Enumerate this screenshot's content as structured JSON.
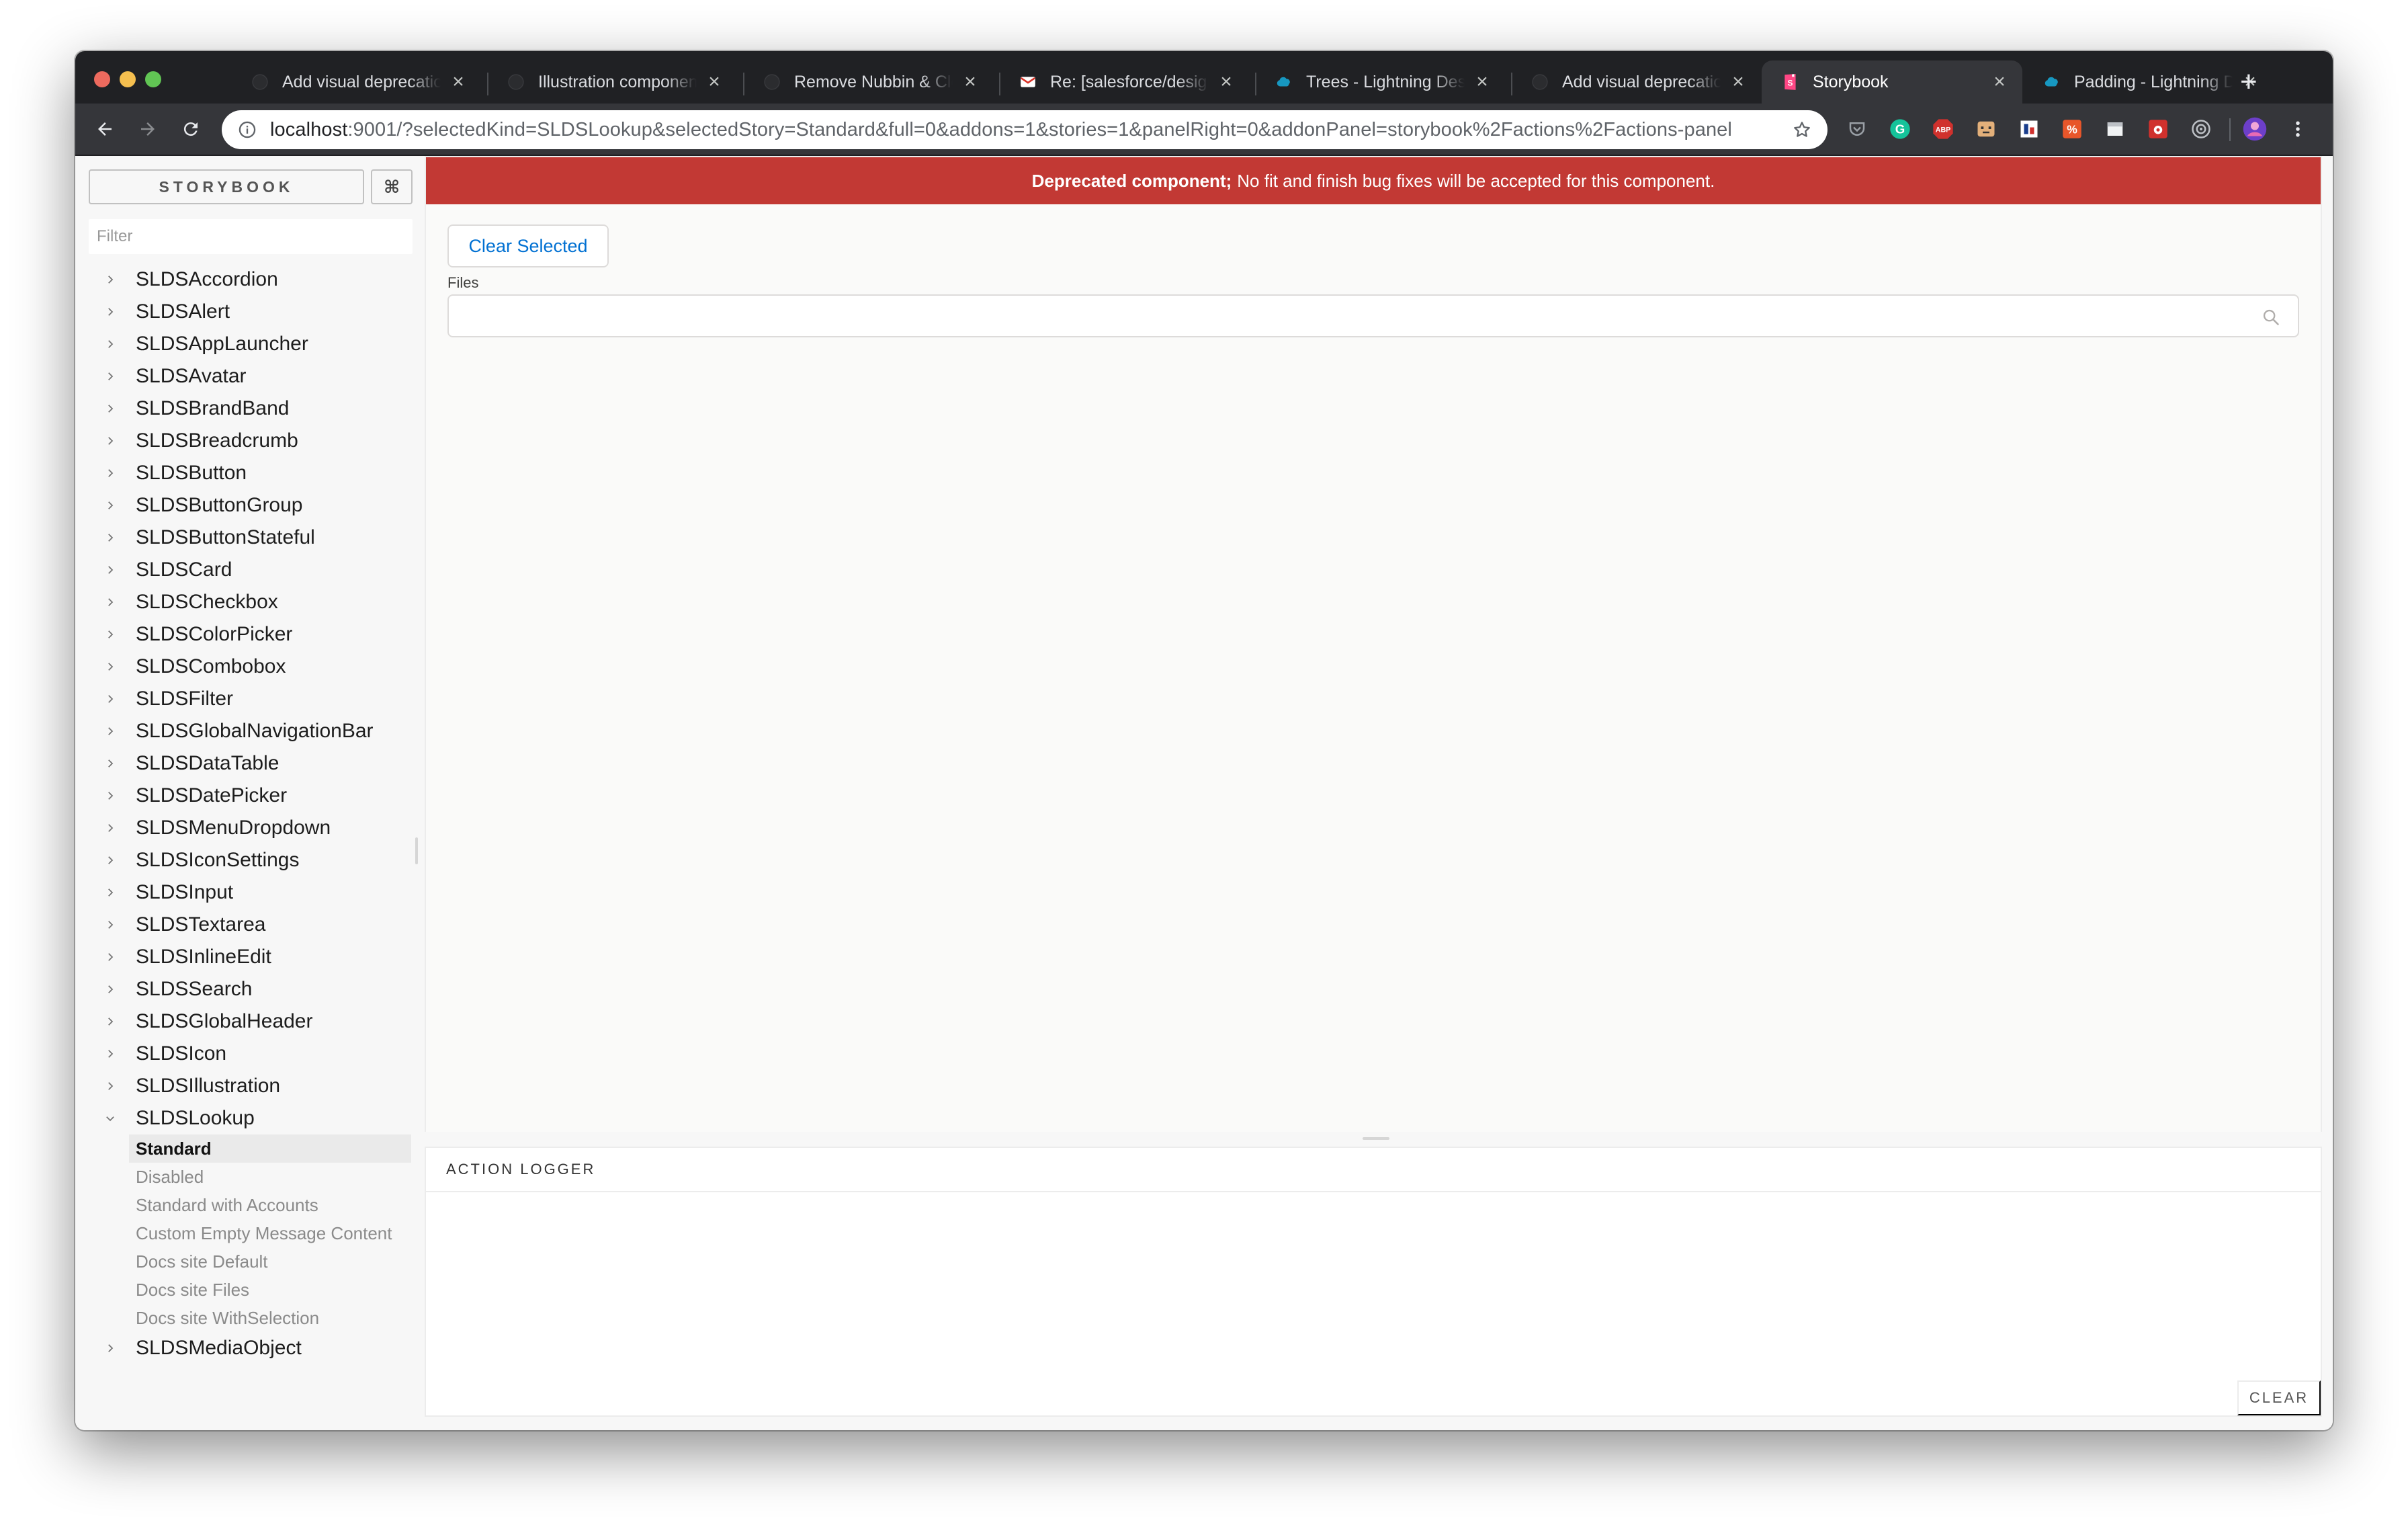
{
  "tabs": [
    {
      "title": "Add visual deprecation",
      "favicon": "github-icon",
      "active": false
    },
    {
      "title": "Illustration component",
      "favicon": "github-icon",
      "active": false
    },
    {
      "title": "Remove Nubbin & Close",
      "favicon": "github-icon",
      "active": false
    },
    {
      "title": "Re: [salesforce/design",
      "favicon": "gmail-icon",
      "active": false
    },
    {
      "title": "Trees - Lightning Design",
      "favicon": "salesforce-cloud-icon",
      "active": false
    },
    {
      "title": "Add visual deprecation",
      "favicon": "github-icon",
      "active": false
    },
    {
      "title": "Storybook",
      "favicon": "storybook-icon",
      "active": true
    },
    {
      "title": "Padding - Lightning Design",
      "favicon": "salesforce-cloud-icon",
      "active": false
    }
  ],
  "toolbar": {
    "url_host": "localhost",
    "url_rest": ":9001/?selectedKind=SLDSLookup&selectedStory=Standard&full=0&addons=1&stories=1&panelRight=0&addonPanel=storybook%2Factions%2Factions-panel"
  },
  "sidebar": {
    "brand": "STORYBOOK",
    "shortcuts_label": "⌘",
    "filter_placeholder": "Filter",
    "kinds_before": [
      "SLDSAccordion",
      "SLDSAlert",
      "SLDSAppLauncher",
      "SLDSAvatar",
      "SLDSBrandBand",
      "SLDSBreadcrumb",
      "SLDSButton",
      "SLDSButtonGroup",
      "SLDSButtonStateful",
      "SLDSCard",
      "SLDSCheckbox",
      "SLDSColorPicker",
      "SLDSCombobox",
      "SLDSFilter",
      "SLDSGlobalNavigationBar",
      "SLDSDataTable",
      "SLDSDatePicker",
      "SLDSMenuDropdown",
      "SLDSIconSettings",
      "SLDSInput",
      "SLDSTextarea",
      "SLDSInlineEdit",
      "SLDSSearch",
      "SLDSGlobalHeader",
      "SLDSIcon",
      "SLDSIllustration"
    ],
    "expanded_kind": "SLDSLookup",
    "stories": [
      {
        "label": "Standard",
        "selected": true
      },
      {
        "label": "Disabled",
        "selected": false
      },
      {
        "label": "Standard with Accounts",
        "selected": false
      },
      {
        "label": "Custom Empty Message Content",
        "selected": false
      },
      {
        "label": "Docs site Default",
        "selected": false
      },
      {
        "label": "Docs site Files",
        "selected": false
      },
      {
        "label": "Docs site WithSelection",
        "selected": false
      }
    ],
    "kinds_after": [
      "SLDSMediaObject"
    ]
  },
  "preview": {
    "banner_strong": "Deprecated component;",
    "banner_text": "No fit and finish bug fixes will be accepted for this component.",
    "banner_color": "#c23934",
    "clear_selected_label": "Clear Selected",
    "files_label": "Files",
    "accent_color": "#0070d2"
  },
  "addon": {
    "tab_label": "ACTION LOGGER",
    "clear_label": "CLEAR"
  }
}
